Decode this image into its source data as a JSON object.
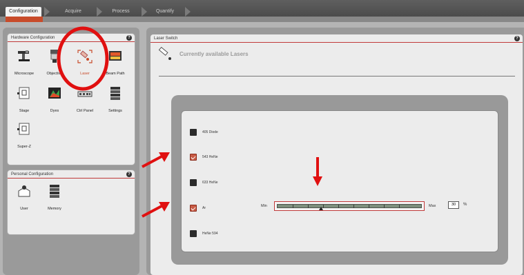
{
  "tabs": [
    {
      "label": "Configuration",
      "active": true
    },
    {
      "label": "Acquire",
      "active": false
    },
    {
      "label": "Process",
      "active": false
    },
    {
      "label": "Quantify",
      "active": false
    }
  ],
  "hardware": {
    "title": "Hardware Configuration",
    "help": "?",
    "items": [
      {
        "label": "Microscope",
        "icon": "microscope-icon"
      },
      {
        "label": "Objective",
        "icon": "objective-icon"
      },
      {
        "label": "Laser",
        "icon": "laser-icon",
        "selected": true
      },
      {
        "label": "Beam Path",
        "icon": "beam-path-icon"
      },
      {
        "label": "Stage",
        "icon": "stage-icon"
      },
      {
        "label": "Dyes",
        "icon": "dyes-icon"
      },
      {
        "label": "Ctrl Panel",
        "icon": "ctrl-panel-icon"
      },
      {
        "label": "Settings",
        "icon": "settings-icon"
      },
      {
        "label": "Super-Z",
        "icon": "super-z-icon"
      }
    ]
  },
  "personal": {
    "title": "Personal Configuration",
    "help": "?",
    "items": [
      {
        "label": "User",
        "icon": "user-icon"
      },
      {
        "label": "Memory",
        "icon": "memory-icon"
      }
    ]
  },
  "laser_switch": {
    "title": "Laser Switch",
    "help": "?",
    "heading": "Currently available Lasers",
    "lasers": [
      {
        "label": "405 Diode",
        "checked": false
      },
      {
        "label": "543 HeNe",
        "checked": true
      },
      {
        "label": "633 HeNe",
        "checked": false
      },
      {
        "label": "Ar",
        "checked": true
      },
      {
        "label": "HeNe 594",
        "checked": false
      }
    ],
    "slider": {
      "min_label": "Min",
      "max_label": "Max",
      "value": "30",
      "unit": "%"
    }
  },
  "colors": {
    "accent": "#c84b2a",
    "highlight": "#e01010"
  }
}
